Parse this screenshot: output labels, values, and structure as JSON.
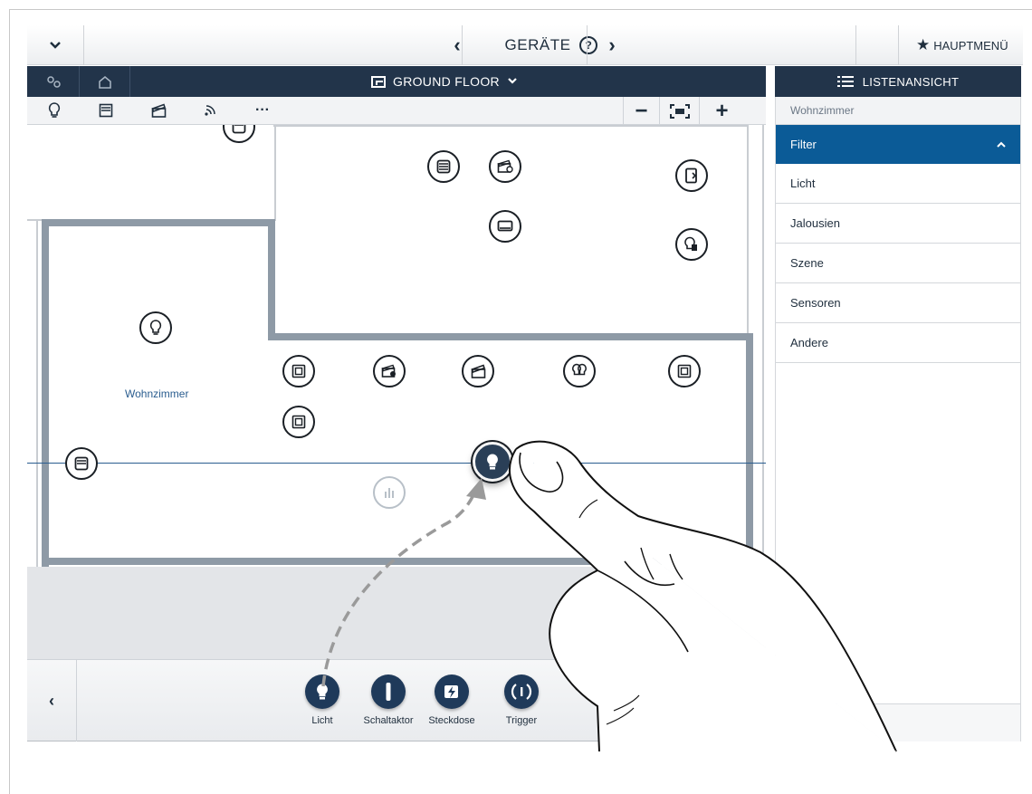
{
  "topbar": {
    "menu_toggle": "⌄",
    "prev": "‹",
    "title": "GERÄTE",
    "help": "?",
    "next": "›",
    "main_menu": "HAUPTMENÜ"
  },
  "header": {
    "floor_name": "GROUND FLOOR",
    "list_view": "LISTENANSICHT"
  },
  "toolbar": {
    "more": "···",
    "zoom_out": "−",
    "zoom_in": "+"
  },
  "plan": {
    "room_label": "Wohnzimmer"
  },
  "list_panel": {
    "room": "Wohnzimmer",
    "filter_label": "Filter",
    "items": [
      "Licht",
      "Jalousien",
      "Szene",
      "Sensoren",
      "Andere"
    ]
  },
  "device_bar": {
    "back": "‹",
    "items": [
      {
        "label": "Licht",
        "icon": "bulb-icon"
      },
      {
        "label": "Schaltaktor",
        "icon": "switch-actuator-icon"
      },
      {
        "label": "Steckdose",
        "icon": "socket-icon"
      },
      {
        "label": "Trigger",
        "icon": "trigger-icon"
      }
    ]
  },
  "colors": {
    "header_dark": "#22344a",
    "filter_active": "#0b5b97",
    "device_dark": "#1f3a5a",
    "wall": "#8e9aa6"
  }
}
